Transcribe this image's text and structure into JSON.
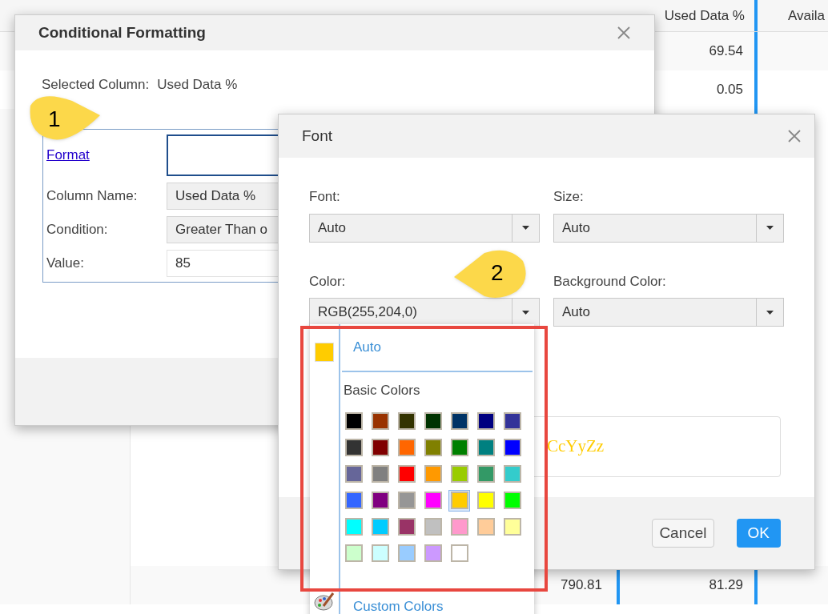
{
  "table": {
    "headers": [
      "Used Data %",
      "Availa"
    ],
    "rows": [
      {
        "used": "69.54"
      },
      {
        "used": "0.05"
      },
      {
        "column_2": "790.81",
        "used": "81.29"
      }
    ]
  },
  "conditional_formatting": {
    "title": "Conditional Formatting",
    "selected_column_label": "Selected Column:",
    "selected_column": "Used Data %",
    "format_link": "Format",
    "fields": [
      {
        "label": "Column Name:",
        "value": "Used Data %",
        "kind": "select"
      },
      {
        "label": "Condition:",
        "value": "Greater Than o",
        "kind": "select"
      },
      {
        "label": "Value:",
        "value": "85",
        "kind": "input"
      }
    ]
  },
  "font_dialog": {
    "title": "Font",
    "fields": [
      {
        "label": "Font:",
        "value": "Auto"
      },
      {
        "label": "Size:",
        "value": "Auto"
      },
      {
        "label": "Color:",
        "value": "RGB(255,204,0)"
      },
      {
        "label": "Background Color:",
        "value": "Auto"
      }
    ],
    "preview": "CcYyZz",
    "buttons": [
      {
        "label": "Cancel",
        "kind": "secondary"
      },
      {
        "label": "OK",
        "kind": "primary"
      }
    ]
  },
  "color_dropdown": {
    "auto_label": "Auto",
    "section_title": "Basic Colors",
    "custom_label": "Custom Colors",
    "swatches": [
      {
        "color": "#000000",
        "selected": false
      },
      {
        "color": "#993300",
        "selected": false
      },
      {
        "color": "#333300",
        "selected": false
      },
      {
        "color": "#003300",
        "selected": false
      },
      {
        "color": "#003366",
        "selected": false
      },
      {
        "color": "#000080",
        "selected": false
      },
      {
        "color": "#333399",
        "selected": false
      },
      {
        "color": "#333333",
        "selected": false
      },
      {
        "color": "#800000",
        "selected": false
      },
      {
        "color": "#ff6600",
        "selected": false
      },
      {
        "color": "#808000",
        "selected": false
      },
      {
        "color": "#008000",
        "selected": false
      },
      {
        "color": "#008080",
        "selected": false
      },
      {
        "color": "#0000ff",
        "selected": false
      },
      {
        "color": "#666699",
        "selected": false
      },
      {
        "color": "#808080",
        "selected": false
      },
      {
        "color": "#ff0000",
        "selected": false
      },
      {
        "color": "#ff9900",
        "selected": false
      },
      {
        "color": "#99cc00",
        "selected": false
      },
      {
        "color": "#339966",
        "selected": false
      },
      {
        "color": "#33cccc",
        "selected": false
      },
      {
        "color": "#3366ff",
        "selected": false
      },
      {
        "color": "#800080",
        "selected": false
      },
      {
        "color": "#969696",
        "selected": false
      },
      {
        "color": "#ff00ff",
        "selected": false
      },
      {
        "color": "#ffcc00",
        "selected": true
      },
      {
        "color": "#ffff00",
        "selected": false
      },
      {
        "color": "#00ff00",
        "selected": false
      },
      {
        "color": "#00ffff",
        "selected": false
      },
      {
        "color": "#00ccff",
        "selected": false
      },
      {
        "color": "#993366",
        "selected": false
      },
      {
        "color": "#c0c0c0",
        "selected": false
      },
      {
        "color": "#ff99cc",
        "selected": false
      },
      {
        "color": "#ffcc99",
        "selected": false
      },
      {
        "color": "#ffff99",
        "selected": false
      },
      {
        "color": "#ccffcc",
        "selected": false
      },
      {
        "color": "#ccffff",
        "selected": false
      },
      {
        "color": "#99ccff",
        "selected": false
      },
      {
        "color": "#cc99ff",
        "selected": false
      },
      {
        "color": "#ffffff",
        "selected": false
      }
    ]
  },
  "callouts": [
    "1",
    "2"
  ]
}
